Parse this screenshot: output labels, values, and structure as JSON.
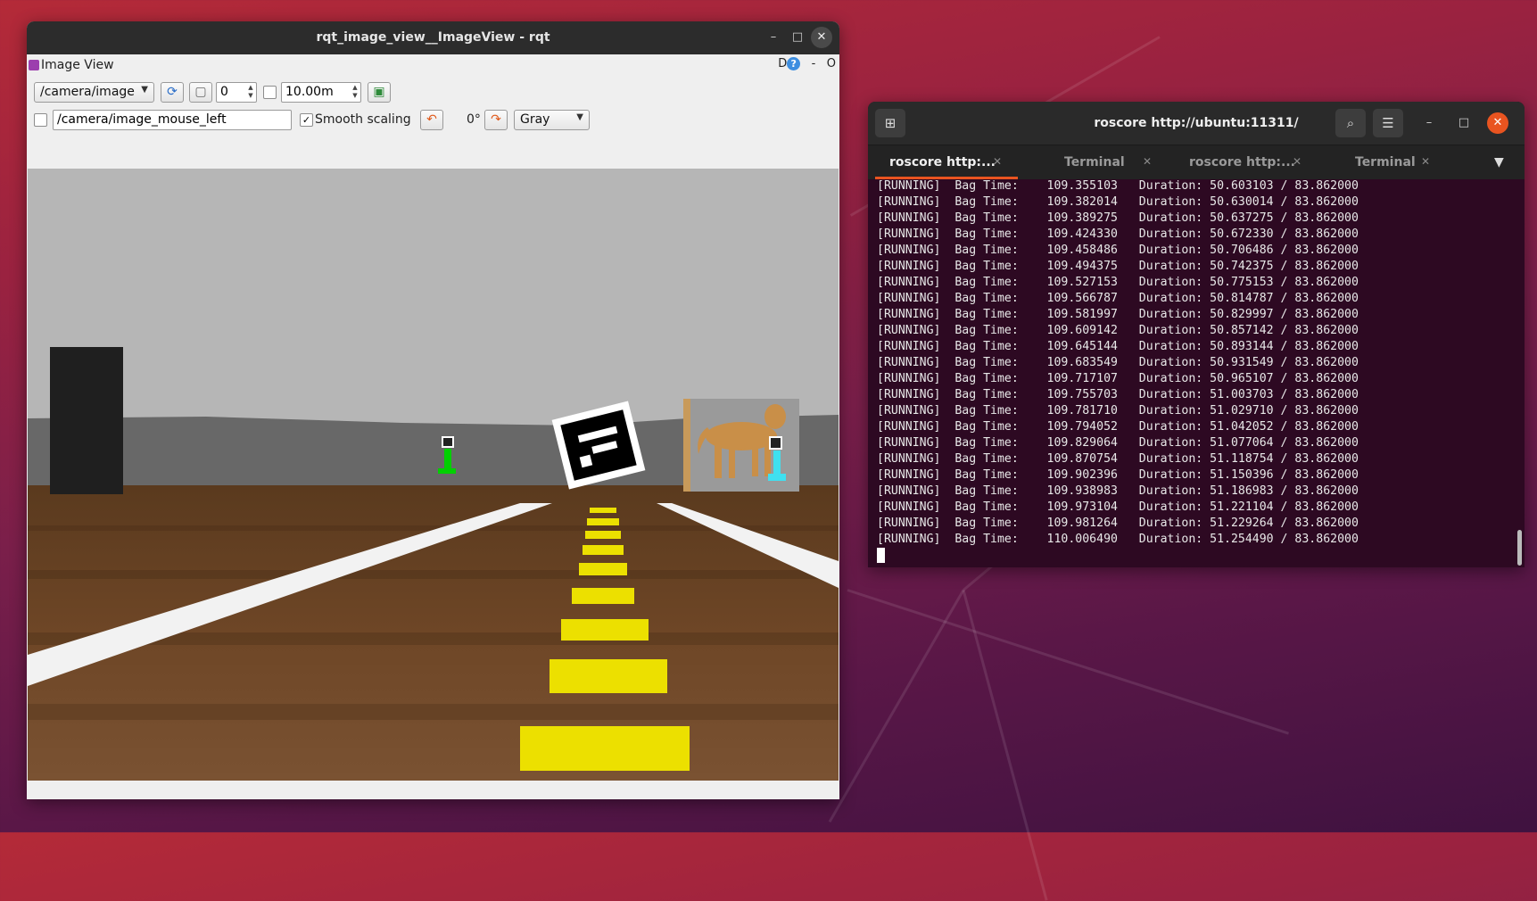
{
  "rqt": {
    "title": "rqt_image_view__ImageView - rqt",
    "dock_title": "Image View",
    "dock_right": "D",
    "dock_help": "?",
    "dock_dash": "-",
    "dock_o": "O",
    "topic": "/camera/image",
    "rate_value": "0",
    "time_value": "10.00m",
    "mouse_topic": "/camera/image_mouse_left",
    "smooth_label": "Smooth scaling",
    "smooth_checked": "✓",
    "rotation": "0°",
    "color_scheme": "Gray"
  },
  "terminal": {
    "title": "roscore http://ubuntu:11311/",
    "tabs": [
      {
        "label": "roscore http:...",
        "active": true
      },
      {
        "label": "Terminal"
      },
      {
        "label": "roscore http:..."
      },
      {
        "label": "Terminal"
      }
    ],
    "lines": [
      "[RUNNING]  Bag Time:    109.355103   Duration: 50.603103 / 83.862000",
      "[RUNNING]  Bag Time:    109.382014   Duration: 50.630014 / 83.862000",
      "[RUNNING]  Bag Time:    109.389275   Duration: 50.637275 / 83.862000",
      "[RUNNING]  Bag Time:    109.424330   Duration: 50.672330 / 83.862000",
      "[RUNNING]  Bag Time:    109.458486   Duration: 50.706486 / 83.862000",
      "[RUNNING]  Bag Time:    109.494375   Duration: 50.742375 / 83.862000",
      "[RUNNING]  Bag Time:    109.527153   Duration: 50.775153 / 83.862000",
      "[RUNNING]  Bag Time:    109.566787   Duration: 50.814787 / 83.862000",
      "[RUNNING]  Bag Time:    109.581997   Duration: 50.829997 / 83.862000",
      "[RUNNING]  Bag Time:    109.609142   Duration: 50.857142 / 83.862000",
      "[RUNNING]  Bag Time:    109.645144   Duration: 50.893144 / 83.862000",
      "[RUNNING]  Bag Time:    109.683549   Duration: 50.931549 / 83.862000",
      "[RUNNING]  Bag Time:    109.717107   Duration: 50.965107 / 83.862000",
      "[RUNNING]  Bag Time:    109.755703   Duration: 51.003703 / 83.862000",
      "[RUNNING]  Bag Time:    109.781710   Duration: 51.029710 / 83.862000",
      "[RUNNING]  Bag Time:    109.794052   Duration: 51.042052 / 83.862000",
      "[RUNNING]  Bag Time:    109.829064   Duration: 51.077064 / 83.862000",
      "[RUNNING]  Bag Time:    109.870754   Duration: 51.118754 / 83.862000",
      "[RUNNING]  Bag Time:    109.902396   Duration: 51.150396 / 83.862000",
      "[RUNNING]  Bag Time:    109.938983   Duration: 51.186983 / 83.862000",
      "[RUNNING]  Bag Time:    109.973104   Duration: 51.221104 / 83.862000",
      "[RUNNING]  Bag Time:    109.981264   Duration: 51.229264 / 83.862000",
      "[RUNNING]  Bag Time:    110.006490   Duration: 51.254490 / 83.862000"
    ]
  }
}
